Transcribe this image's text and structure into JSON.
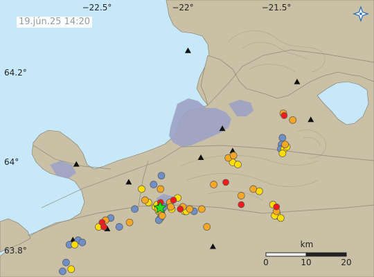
{
  "timestamp": "19.jún.25  14:20",
  "longitude_labels": [
    "−22.5°",
    "−22°",
    "−21.5°"
  ],
  "latitude_labels": [
    "64.2°",
    "64°",
    "63.8°"
  ],
  "scale": {
    "unit": "km",
    "ticks": [
      "0",
      "10",
      "20"
    ]
  },
  "logo_icon": "compass-star-icon",
  "colors": {
    "sea": "#c6e8f8",
    "land": "#c9c0a6",
    "lava": "#9da3c6",
    "contour": "#a89880",
    "road": "#8a8474",
    "quake_red": "#ee1c1c",
    "quake_orange": "#f5a623",
    "quake_yellow": "#ffdd00",
    "quake_blue": "#6f8fc6",
    "largest_star": "#22dd22"
  },
  "legend_note": "",
  "quakes": [
    {
      "lon": -22.42,
      "lat": 63.88,
      "cls": "blue"
    },
    {
      "lon": -22.37,
      "lat": 63.86,
      "cls": "blue"
    },
    {
      "lon": -22.47,
      "lat": 63.87,
      "cls": "red"
    },
    {
      "lon": -22.45,
      "lat": 63.875,
      "cls": "orange"
    },
    {
      "lon": -22.49,
      "lat": 63.86,
      "cls": "yellow"
    },
    {
      "lon": -22.61,
      "lat": 63.83,
      "cls": "blue"
    },
    {
      "lon": -22.63,
      "lat": 63.82,
      "cls": "yellow"
    },
    {
      "lon": -22.66,
      "lat": 63.82,
      "cls": "blue"
    },
    {
      "lon": -22.22,
      "lat": 63.92,
      "cls": "orange"
    },
    {
      "lon": -22.2,
      "lat": 63.915,
      "cls": "yellow"
    },
    {
      "lon": -22.17,
      "lat": 63.955,
      "cls": "blue"
    },
    {
      "lon": -22.24,
      "lat": 63.945,
      "cls": "yellow"
    },
    {
      "lon": -22.28,
      "lat": 63.9,
      "cls": "blue"
    },
    {
      "lon": -22.31,
      "lat": 63.87,
      "cls": "orange"
    },
    {
      "lon": -22.16,
      "lat": 63.905,
      "cls": "yellow"
    },
    {
      "lon": -22.15,
      "lat": 63.91,
      "cls": "yellow"
    },
    {
      "lon": -22.145,
      "lat": 63.9,
      "cls": "yellow"
    },
    {
      "lon": -22.14,
      "lat": 63.895,
      "cls": "yellow"
    },
    {
      "lon": -22.135,
      "lat": 63.905,
      "cls": "red"
    },
    {
      "lon": -22.13,
      "lat": 63.915,
      "cls": "red"
    },
    {
      "lon": -22.125,
      "lat": 63.89,
      "cls": "orange"
    },
    {
      "lon": -22.12,
      "lat": 63.9,
      "cls": "blue"
    },
    {
      "lon": -22.11,
      "lat": 63.905,
      "cls": "blue"
    },
    {
      "lon": -22.13,
      "lat": 63.88,
      "cls": "blue"
    },
    {
      "lon": -22.14,
      "lat": 63.875,
      "cls": "blue"
    },
    {
      "lon": -22.12,
      "lat": 63.885,
      "cls": "orange"
    },
    {
      "lon": -22.075,
      "lat": 63.915,
      "cls": "orange"
    },
    {
      "lon": -22.07,
      "lat": 63.905,
      "cls": "orange"
    },
    {
      "lon": -22.065,
      "lat": 63.9,
      "cls": "yellow"
    },
    {
      "lon": -22.055,
      "lat": 63.92,
      "cls": "red"
    },
    {
      "lon": -22.03,
      "lat": 63.925,
      "cls": "yellow"
    },
    {
      "lon": -22.015,
      "lat": 63.9,
      "cls": "red"
    },
    {
      "lon": -22.0,
      "lat": 63.905,
      "cls": "orange"
    },
    {
      "lon": -21.99,
      "lat": 63.895,
      "cls": "yellow"
    },
    {
      "lon": -21.98,
      "lat": 63.895,
      "cls": "yellow"
    },
    {
      "lon": -21.96,
      "lat": 63.9,
      "cls": "orange"
    },
    {
      "lon": -21.935,
      "lat": 63.895,
      "cls": "blue"
    },
    {
      "lon": -21.89,
      "lat": 63.9,
      "cls": "orange"
    },
    {
      "lon": -21.86,
      "lat": 63.86,
      "cls": "orange"
    },
    {
      "lon": -22.13,
      "lat": 63.945,
      "cls": "orange"
    },
    {
      "lon": -22.125,
      "lat": 63.975,
      "cls": "blue"
    },
    {
      "lon": -21.82,
      "lat": 63.955,
      "cls": "orange"
    },
    {
      "lon": -21.75,
      "lat": 63.96,
      "cls": "red"
    },
    {
      "lon": -21.735,
      "lat": 64.015,
      "cls": "orange"
    },
    {
      "lon": -21.71,
      "lat": 64.005,
      "cls": "yellow"
    },
    {
      "lon": -21.705,
      "lat": 64.02,
      "cls": "orange"
    },
    {
      "lon": -21.68,
      "lat": 64.0,
      "cls": "yellow"
    },
    {
      "lon": -21.66,
      "lat": 63.93,
      "cls": "orange"
    },
    {
      "lon": -21.66,
      "lat": 63.91,
      "cls": "red"
    },
    {
      "lon": -21.59,
      "lat": 63.945,
      "cls": "orange"
    },
    {
      "lon": -21.555,
      "lat": 63.94,
      "cls": "yellow"
    },
    {
      "lon": -21.455,
      "lat": 63.905,
      "cls": "red"
    },
    {
      "lon": -21.455,
      "lat": 63.895,
      "cls": "orange"
    },
    {
      "lon": -21.45,
      "lat": 63.885,
      "cls": "yellow"
    },
    {
      "lon": -21.465,
      "lat": 63.885,
      "cls": "yellow"
    },
    {
      "lon": -21.43,
      "lat": 63.88,
      "cls": "yellow"
    },
    {
      "lon": -21.475,
      "lat": 63.91,
      "cls": "yellow"
    },
    {
      "lon": -21.41,
      "lat": 64.11,
      "cls": "red"
    },
    {
      "lon": -21.415,
      "lat": 64.115,
      "cls": "orange"
    },
    {
      "lon": -21.42,
      "lat": 64.06,
      "cls": "blue"
    },
    {
      "lon": -21.405,
      "lat": 64.045,
      "cls": "orange"
    },
    {
      "lon": -21.41,
      "lat": 64.035,
      "cls": "yellow"
    },
    {
      "lon": -21.42,
      "lat": 64.025,
      "cls": "yellow"
    },
    {
      "lon": -21.425,
      "lat": 64.045,
      "cls": "blue"
    },
    {
      "lon": -21.43,
      "lat": 64.035,
      "cls": "blue"
    },
    {
      "lon": -21.395,
      "lat": 64.04,
      "cls": "yellow"
    },
    {
      "lon": -21.36,
      "lat": 64.1,
      "cls": "orange"
    },
    {
      "lon": -22.68,
      "lat": 63.78,
      "cls": "blue"
    },
    {
      "lon": -22.7,
      "lat": 63.76,
      "cls": "blue"
    },
    {
      "lon": -22.65,
      "lat": 63.765,
      "cls": "yellow"
    },
    {
      "lon": -22.585,
      "lat": 63.825,
      "cls": "blue"
    },
    {
      "lon": -22.46,
      "lat": 63.86,
      "cls": "red"
    }
  ],
  "largest": {
    "lon": -22.132,
    "lat": 63.903
  },
  "peaks": [
    {
      "lon": -21.97,
      "lat": 64.255
    },
    {
      "lon": -21.335,
      "lat": 64.185
    },
    {
      "lon": -21.255,
      "lat": 64.1
    },
    {
      "lon": -21.77,
      "lat": 64.08
    },
    {
      "lon": -21.895,
      "lat": 64.015
    },
    {
      "lon": -22.315,
      "lat": 63.96
    },
    {
      "lon": -22.62,
      "lat": 64.0
    },
    {
      "lon": -22.64,
      "lat": 63.83
    },
    {
      "lon": -22.44,
      "lat": 63.855
    },
    {
      "lon": -21.825,
      "lat": 63.815
    },
    {
      "lon": -21.45,
      "lat": 63.895
    },
    {
      "lon": -21.71,
      "lat": 64.03
    }
  ]
}
